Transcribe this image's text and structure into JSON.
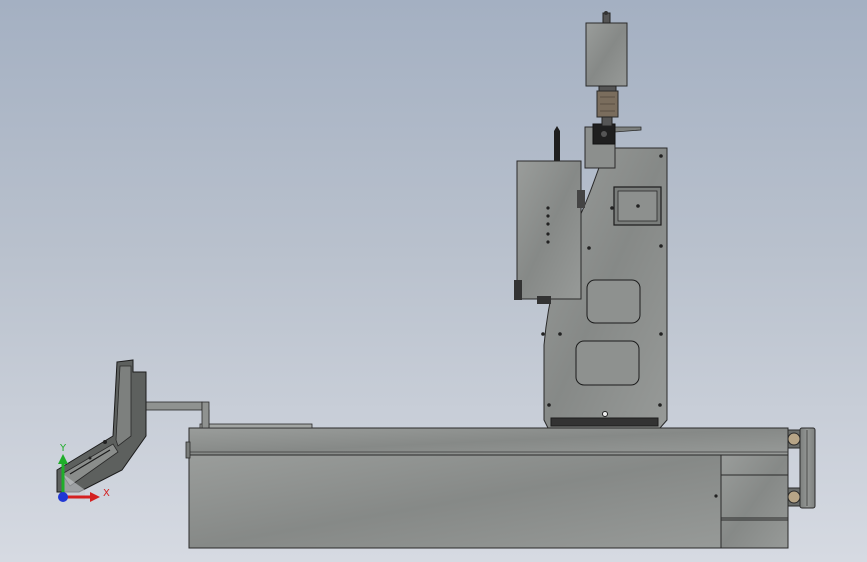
{
  "viewport": {
    "background_top": "#a4b0c2",
    "background_bottom": "#d6dae2"
  },
  "model": {
    "metal_color": "#8e918f",
    "metal_dark": "#6f7270",
    "outline_color": "#2a2a2a"
  },
  "triad": {
    "x_label": "X",
    "y_label": "Y",
    "x_color": "#d42020",
    "y_color": "#1fae2a",
    "z_color": "#2037d4"
  }
}
